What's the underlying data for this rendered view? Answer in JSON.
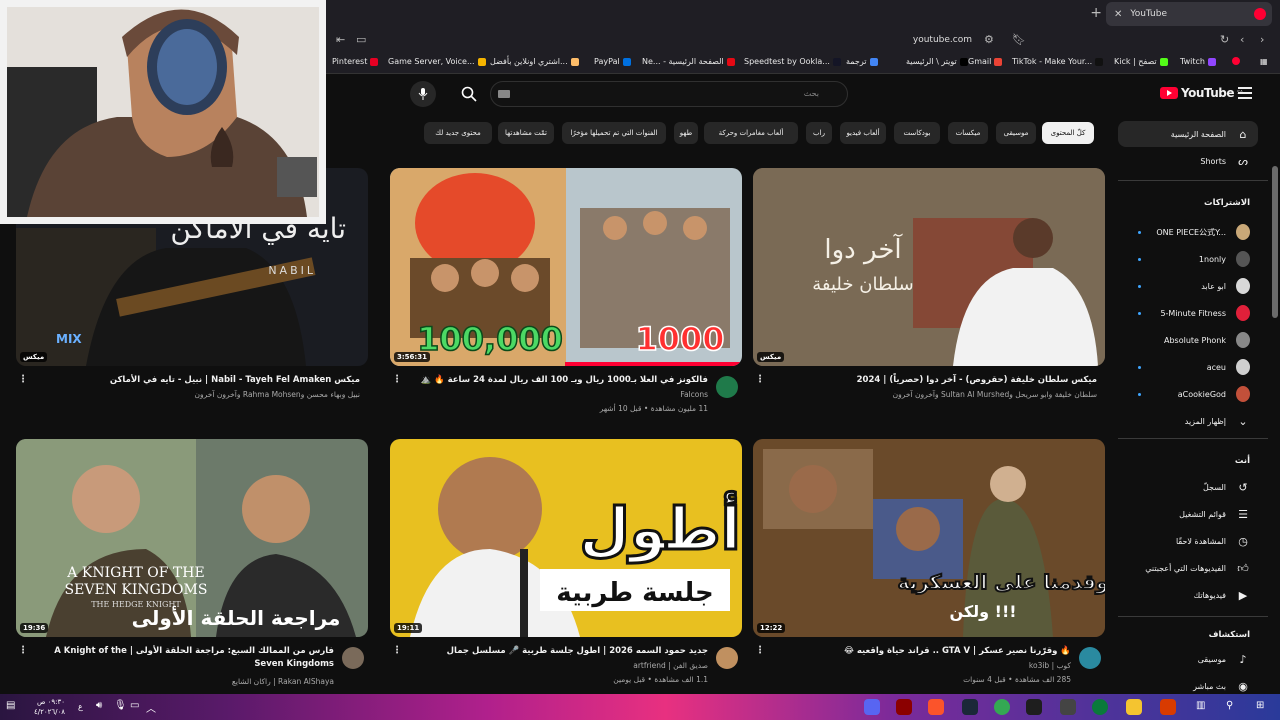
{
  "browser": {
    "tab_title": "YouTube",
    "tab_close": "✕",
    "new_tab": "+",
    "url": "youtube.com",
    "bookmarks": [
      {
        "label": "Pinterest",
        "color": "#e60023"
      },
      {
        "label": "Game Server, Voice...",
        "color": "#f5b400"
      },
      {
        "label": "اشتري اونلاين بأفضل...",
        "color": "#febd69"
      },
      {
        "label": "PayPal",
        "color": "#0070e0"
      },
      {
        "label": "Ne... - الصفحة الرئيسية",
        "color": "#e50914"
      },
      {
        "label": "Speedtest by Ookla...",
        "color": "#141526"
      },
      {
        "label": "ترجمة",
        "color": "#4285f4"
      },
      {
        "label": "تويتر \\ الرئيسية",
        "color": "#000000"
      },
      {
        "label": "Gmail",
        "color": "#ea4335"
      },
      {
        "label": "TikTok - Make Your...",
        "color": "#111111"
      },
      {
        "label": "Kick | تصفح",
        "color": "#53fc18"
      },
      {
        "label": "Twitch",
        "color": "#9146ff"
      }
    ]
  },
  "youtube": {
    "logo_text": "YouTube",
    "country": "SA",
    "search_placeholder": "بحث",
    "chips": [
      {
        "label": "كلّ المحتوى",
        "active": true
      },
      {
        "label": "موسيقى"
      },
      {
        "label": "ميكسات"
      },
      {
        "label": "بودكاست"
      },
      {
        "label": "ألعاب فيديو"
      },
      {
        "label": "راب"
      },
      {
        "label": "ألعاب مغامرات وحركة"
      },
      {
        "label": "طهو"
      },
      {
        "label": "الفنوات التي تم تحميلها مؤخرًا"
      },
      {
        "label": "تمّت مشاهدتها"
      },
      {
        "label": "محتوى جديد لك"
      }
    ],
    "videos": [
      {
        "title": "ميكس Nabil - Tayeh Fel Amaken | نبيل - تايه في الأماكن",
        "channel": "نبيل وبهاء محسن وRahma Mohsen وآخرون آخرون",
        "meta": "",
        "duration": "ميكس",
        "overlay1": "تايه في الأماكن",
        "overlay2": "NABIL",
        "overlay3": "MIX"
      },
      {
        "title": "فالكونز في العلا بـ1000 ريال وبـ 100 الف ريال لمدة 24 ساعة 🔥 ⛰️",
        "channel": "Falcons",
        "meta": "11 مليون مشاهدة • قبل 10 أشهر",
        "duration": "3:56:31",
        "overlay1": "100,000",
        "overlay2": "1000",
        "currency": "﷼"
      },
      {
        "title": "ميكس سلطان خليفة (حقروص) - آخر دوا (حصرياً) | 2024",
        "channel": "سلطان خليفة وابو سريحل وSultan Al Murshed وآخرون آخرون",
        "meta": "",
        "duration": "ميكس",
        "overlay1": "آخر دوا",
        "overlay2": "سلطان خليفة"
      },
      {
        "title": "فارس من الممالك السبع: مراجعة الحلقة الأولى | A Knight of the Seven Kingdoms",
        "channel": "Rakan AlShaya | راكان الشايع",
        "meta": "",
        "duration": "19:36",
        "overlay1": "A KNIGHT OF THE SEVEN KINGDOMS",
        "overlay2": "THE HEDGE KNIGHT",
        "overlay3": "مراجعة الحلقة الأولى"
      },
      {
        "title": "جديد حمود السمه 2026 | اطول جلسة طربية 🎤 مسلسل جمال",
        "channel": "صديق الفن | artfriend",
        "meta": "1.1 الف مشاهدة • قبل يومين",
        "duration": "19:11",
        "overlay1": "أطول",
        "overlay2": "جلسة طربية"
      },
      {
        "title": "🔥 وقرّرنا نصير عسكر | GTA V .. قراند حياة واقعيه 😂",
        "channel": "كوب | ko3ib",
        "meta": "285 الف مشاهدة • قبل 4 سنوات",
        "duration": "12:22",
        "overlay1": "وقدمنا على العسكرية",
        "overlay2": "ولكن !!!"
      }
    ],
    "sidebar": {
      "main": [
        {
          "label": "الصفحة الرئيسية",
          "icon": "home-icon",
          "active": true
        },
        {
          "label": "Shorts",
          "icon": "shorts-icon"
        }
      ],
      "subscriptions_title": "الاشتراكات",
      "subscriptions": [
        {
          "label": "ONE PIECE公式Y...",
          "color": "#c9a878"
        },
        {
          "label": "1nonly",
          "color": "#555555"
        },
        {
          "label": "ابو عابد",
          "color": "#d8d8d8"
        },
        {
          "label": "5-Minute Fitness",
          "color": "#e0203a"
        },
        {
          "label": "Absolute Phonk",
          "color": "#888888"
        },
        {
          "label": "aceu",
          "color": "#cfcfcf"
        },
        {
          "label": "aCookieGod",
          "color": "#c2503a"
        }
      ],
      "show_more": "إظهار المزيد",
      "you_title": "أنت",
      "you": [
        {
          "label": "السجلّ",
          "icon": "history-icon"
        },
        {
          "label": "قوائم التشغيل",
          "icon": "playlists-icon"
        },
        {
          "label": "المشاهدة لاحقًا",
          "icon": "watch-later-icon"
        },
        {
          "label": "الفيديوهات التي أعجبتني",
          "icon": "like-icon"
        },
        {
          "label": "فيديوهاتك",
          "icon": "your-videos-icon"
        }
      ],
      "explore_title": "استكشاف",
      "explore": [
        {
          "label": "موسيقى",
          "icon": "music-icon"
        },
        {
          "label": "بث مباشر",
          "icon": "live-icon"
        }
      ]
    }
  },
  "taskbar": {
    "time": "٠٩:٣٠ ص",
    "date": "٤/٢٠٢٦/٠٨",
    "lang": "ع"
  }
}
